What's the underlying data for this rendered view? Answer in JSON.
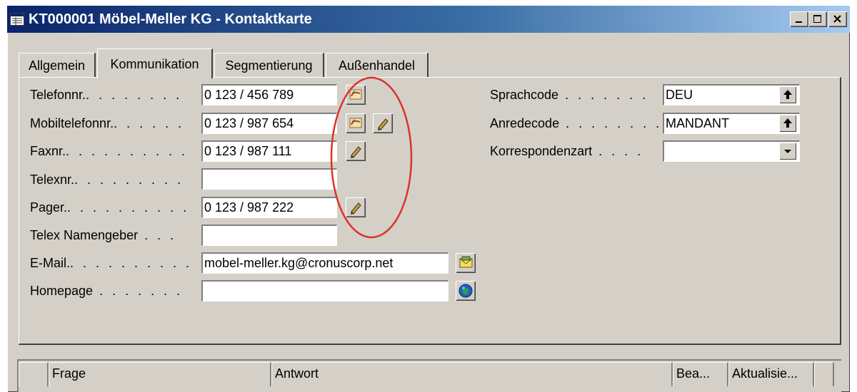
{
  "window": {
    "title": "KT000001 Möbel-Meller KG - Kontaktkarte"
  },
  "tabs": [
    {
      "label": "Allgemein",
      "active": false
    },
    {
      "label": "Kommunikation",
      "active": true
    },
    {
      "label": "Segmentierung",
      "active": false
    },
    {
      "label": "Außenhandel",
      "active": false
    }
  ],
  "fields": {
    "telefon": {
      "label": "Telefonnr.",
      "value": "0 123 / 456 789"
    },
    "mobil": {
      "label": "Mobiltelefonnr.",
      "value": "0 123 / 987 654"
    },
    "fax": {
      "label": "Faxnr.",
      "value": "0 123 / 987 111"
    },
    "telex": {
      "label": "Telexnr.",
      "value": ""
    },
    "pager": {
      "label": "Pager.",
      "value": "0 123 / 987 222"
    },
    "telex_namengeber": {
      "label": "Telex Namengeber",
      "value": ""
    },
    "email": {
      "label": "E-Mail.",
      "value": "mobel-meller.kg@cronuscorp.net"
    },
    "homepage": {
      "label": "Homepage",
      "value": ""
    },
    "sprachcode": {
      "label": "Sprachcode",
      "value": "DEU"
    },
    "anredecode": {
      "label": "Anredecode",
      "value": "MANDANT"
    },
    "korrespondenzart": {
      "label": "Korrespondenzart",
      "value": ""
    }
  },
  "grid": {
    "columns": [
      "Frage",
      "Antwort",
      "Bea...",
      "Aktualisie..."
    ]
  },
  "icons": {
    "dial": "phone-dial-icon",
    "edit": "pencil-icon",
    "mail": "envelope-icon",
    "web": "globe-icon",
    "lookup": "arrow-up-icon",
    "dropdown": "chevron-down-icon"
  },
  "colors": {
    "title_start": "#0a246a",
    "title_end": "#a6caf0",
    "window_bg": "#d4d0c8",
    "highlight_oval": "#d9342b"
  }
}
